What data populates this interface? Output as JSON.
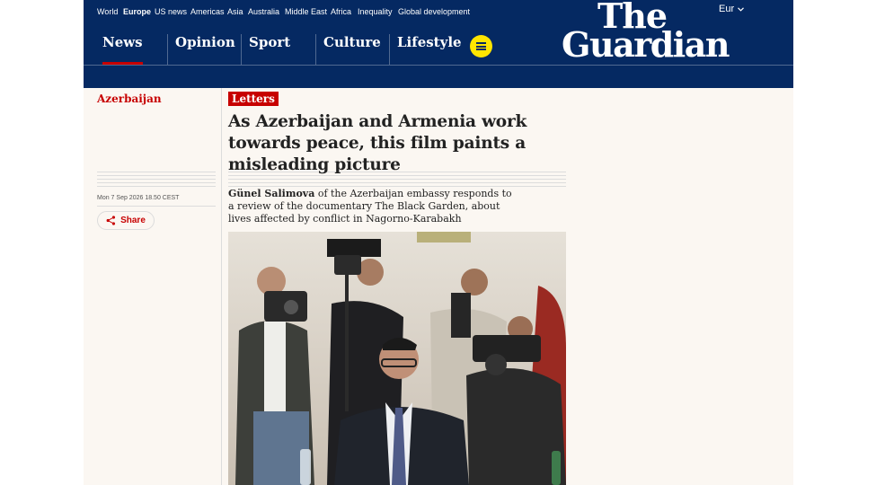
{
  "masthead": {
    "edition": "Eur",
    "logo_line1": "The",
    "logo_line2": "Guardian",
    "pillars": [
      "News",
      "Opinion",
      "Sport",
      "Culture",
      "Lifestyle"
    ]
  },
  "subnav": {
    "items": [
      "World",
      "Europe",
      "US news",
      "Americas",
      "Asia",
      "Australia",
      "Middle East",
      "Africa",
      "Inequality",
      "Global development"
    ],
    "active": "Europe"
  },
  "article": {
    "section": "Azerbaijan",
    "kicker": "Letters",
    "headline": "As Azerbaijan and Armenia work towards peace, this film paints a misleading picture",
    "author": "Günel Salimova",
    "standfirst_rest": " of the Azerbaijan embassy responds to a review of the documentary The Black Garden, about lives affected by conflict in Nagorno-Karabakh",
    "dateline": "Mon 7 Sep 2026 18.50 CEST",
    "share_label": "Share"
  },
  "colors": {
    "brand_navy": "#052962",
    "news_red": "#c70000",
    "menu_yellow": "#ffe500",
    "page_background": "#fbf7f2"
  },
  "icons": {
    "menu": "hamburger-icon",
    "share": "share-icon",
    "edition": "chevron-down-icon"
  }
}
